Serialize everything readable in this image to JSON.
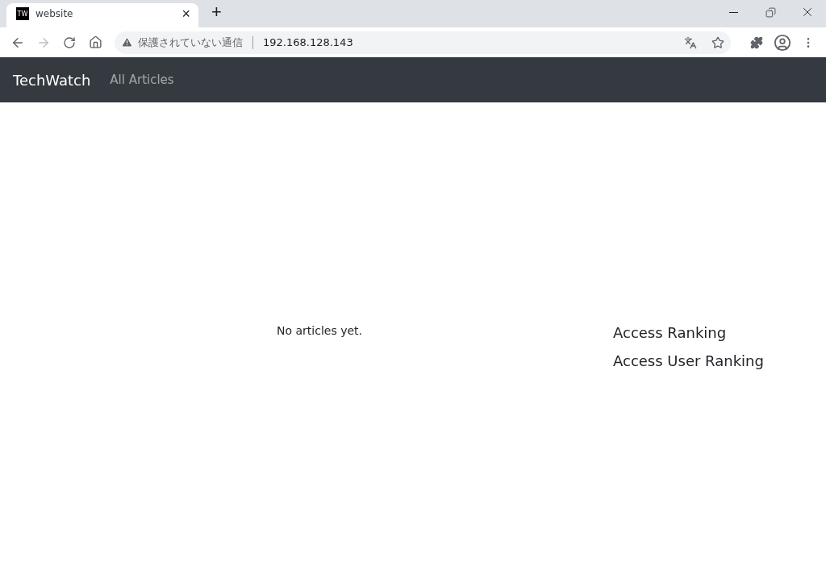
{
  "browser": {
    "tab": {
      "favicon": "TW",
      "title": "website",
      "close": "×"
    },
    "new_tab": "+",
    "security_label": "保護されていない通信",
    "url": "192.168.128.143"
  },
  "navbar": {
    "brand": "TechWatch",
    "links": [
      {
        "label": "All Articles"
      }
    ]
  },
  "main": {
    "empty_message": "No articles yet."
  },
  "sidebar": {
    "headings": [
      "Access Ranking",
      "Access User Ranking"
    ]
  }
}
